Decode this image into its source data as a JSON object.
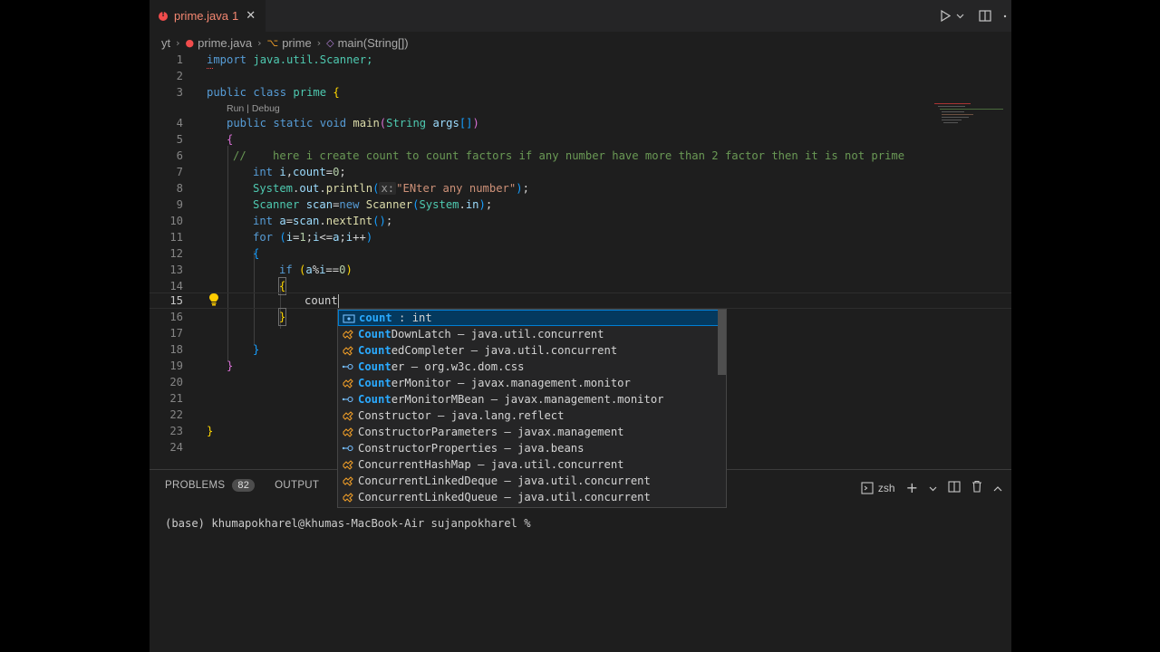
{
  "tab": {
    "title": "prime.java",
    "problem_count": "1",
    "close": "✕"
  },
  "breadcrumb": [
    "yt",
    "prime.java",
    "prime",
    "main(String[])"
  ],
  "codelens": "Run | Debug",
  "line_numbers": [
    "1",
    "2",
    "3",
    "4",
    "5",
    "6",
    "7",
    "8",
    "9",
    "10",
    "11",
    "12",
    "13",
    "14",
    "15",
    "16",
    "17",
    "18",
    "19",
    "20",
    "21",
    "22",
    "23",
    "24"
  ],
  "code": {
    "l1_import": "import",
    "l1_pkg": " java.util.Scanner;",
    "l3_public": "public",
    "l3_class": " class",
    "l3_name": " prime",
    "l3_brace": " {",
    "l4_public": "public",
    "l4_static": " static",
    "l4_void": " void",
    "l4_main": " main",
    "l4_open": "(",
    "l4_string": "String",
    "l4_args": " args",
    "l4_arr": "[]",
    "l4_close": ")",
    "l5": "{",
    "l6": "//    here i create count to count factors if any number have more than 2 factor then it is not prime",
    "l7_int": "int",
    "l7_i": " i",
    "l7_comma": ",",
    "l7_count": "count",
    "l7_eq": "=",
    "l7_zero": "0",
    "l7_semi": ";",
    "l8_system": "System",
    "l8_dot1": ".",
    "l8_out": "out",
    "l8_dot2": ".",
    "l8_println": "println",
    "l8_open": "(",
    "l8_hint": "x:",
    "l8_str": "\"ENter any number\"",
    "l8_close": ")",
    "l8_semi": ";",
    "l9_scanner": "Scanner",
    "l9_scan": " scan",
    "l9_eq": "=",
    "l9_new": "new",
    "l9_scanner2": " Scanner",
    "l9_open": "(",
    "l9_system": "System",
    "l9_dot": ".",
    "l9_in": "in",
    "l9_close": ")",
    "l9_semi": ";",
    "l10_int": "int",
    "l10_a": " a",
    "l10_eq": "=",
    "l10_scan": "scan",
    "l10_dot": ".",
    "l10_next": "nextInt",
    "l10_parens": "()",
    "l10_semi": ";",
    "l11_for": "for",
    "l11_open": " (",
    "l11_i": "i",
    "l11_eq": "=",
    "l11_one": "1",
    "l11_s1": ";",
    "l11_i2": "i",
    "l11_le": "<=",
    "l11_a": "a",
    "l11_s2": ";",
    "l11_i3": "i",
    "l11_pp": "++",
    "l11_close": ")",
    "l12": "{",
    "l13_if": "if",
    "l13_open": " (",
    "l13_a": "a",
    "l13_mod": "%",
    "l13_i": "i",
    "l13_eq": "==",
    "l13_zero": "0",
    "l13_close": ")",
    "l14": "{",
    "l15": "count",
    "l16": "}",
    "l18": "}",
    "l19": "}",
    "l23": "}"
  },
  "suggestions": [
    {
      "m": "count",
      "r": " : int",
      "icon": "variable-icon"
    },
    {
      "m": "Count",
      "r": "DownLatch – java.util.concurrent",
      "icon": "class-icon"
    },
    {
      "m": "Count",
      "r": "edCompleter – java.util.concurrent",
      "icon": "class-icon"
    },
    {
      "m": "Count",
      "r": "er – org.w3c.dom.css",
      "icon": "interface-icon"
    },
    {
      "m": "Count",
      "r": "erMonitor – javax.management.monitor",
      "icon": "class-icon"
    },
    {
      "m": "Count",
      "r": "erMonitorMBean – javax.management.monitor",
      "icon": "interface-icon"
    },
    {
      "raw": "Constructor – java.lang.reflect",
      "icon": "class-icon"
    },
    {
      "raw": "ConstructorParameters – javax.management",
      "icon": "class-icon"
    },
    {
      "raw": "ConstructorProperties – java.beans",
      "icon": "interface-icon"
    },
    {
      "raw": "ConcurrentHashMap – java.util.concurrent",
      "icon": "class-icon"
    },
    {
      "raw": "ConcurrentLinkedDeque – java.util.concurrent",
      "icon": "class-icon"
    },
    {
      "raw": "ConcurrentLinkedQueue – java.util.concurrent",
      "icon": "class-icon"
    }
  ],
  "panel": {
    "problems_label": "PROBLEMS",
    "problems_count": "82",
    "output_label": "OUTPUT",
    "debug_label": "D",
    "shell": "zsh",
    "terminal_prompt": "(base) khumapokharel@khumas-MacBook-Air sujanpokharel %"
  },
  "colors": {
    "keyword": "#569cd6",
    "type": "#4ec9b0",
    "string": "#ce9178",
    "comment": "#6a9955",
    "match": "#2aaaff",
    "error": "#f14c4c"
  }
}
